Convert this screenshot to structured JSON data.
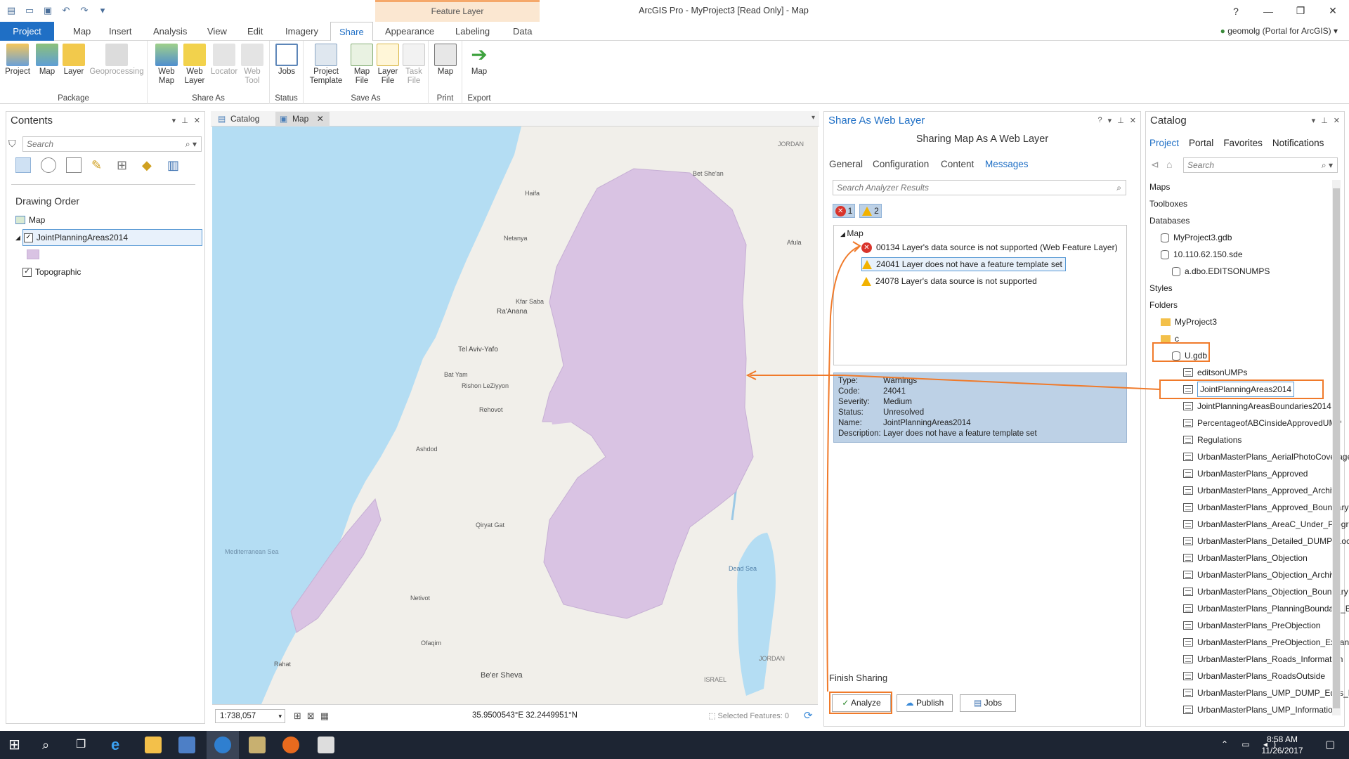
{
  "window": {
    "title": "ArcGIS Pro - MyProject3 [Read Only] - Map",
    "context_group": "Feature Layer",
    "help": "?",
    "portal_user": "geomolg (Portal for ArcGIS)"
  },
  "ribbon_tabs": [
    "Project",
    "Map",
    "Insert",
    "Analysis",
    "View",
    "Edit",
    "Imagery",
    "Share",
    "Appearance",
    "Labeling",
    "Data"
  ],
  "ribbon": {
    "package": {
      "label": "Package",
      "buttons": [
        "Project",
        "Map",
        "Layer",
        "Geoprocessing"
      ]
    },
    "share_as": {
      "label": "Share As",
      "buttons": [
        "Web Map",
        "Web Layer",
        "Locator",
        "Web Tool"
      ]
    },
    "status": {
      "label": "Status",
      "buttons": [
        "Jobs"
      ]
    },
    "save_as": {
      "label": "Save As",
      "buttons": [
        "Project Template",
        "Map File",
        "Layer File",
        "Task File"
      ]
    },
    "print": {
      "label": "Print",
      "buttons": [
        "Map"
      ]
    },
    "export": {
      "label": "Export",
      "buttons": [
        "Map"
      ]
    }
  },
  "contents": {
    "title": "Contents",
    "search_placeholder": "Search",
    "section": "Drawing Order",
    "map_item": "Map",
    "layer": "JointPlanningAreas2014",
    "basemap": "Topographic"
  },
  "map": {
    "tabs": [
      "Catalog",
      "Map"
    ],
    "scale": "1:738,057",
    "coords": "35.9500543°E 32.2449951°N",
    "selected": "Selected Features: 0",
    "labels": [
      "Haifa",
      "Netanya",
      "Ra'Anana",
      "Tel Aviv-Yafo",
      "Bat Yam",
      "Rishon LeZiyyon",
      "Rehovot",
      "Ashdod",
      "Qiryat Gat",
      "Netivot",
      "Rahat",
      "Ofaqim",
      "Be'er Sheva",
      "Dead Sea",
      "Mediterranean Sea",
      "JORDAN",
      "ISRAEL",
      "Afula",
      "Kfar Saba",
      "Bet She'an"
    ]
  },
  "share": {
    "title": "Share As Web Layer",
    "subtitle": "Sharing Map As A Web Layer",
    "subtabs": [
      "General",
      "Configuration",
      "Content",
      "Messages"
    ],
    "search_placeholder": "Search Analyzer Results",
    "error_count": "1",
    "warning_count": "2",
    "group": "Map",
    "messages": [
      {
        "type": "error",
        "text": "00134 Layer's data source is not supported (Web Feature Layer)"
      },
      {
        "type": "warning",
        "text": "24041 Layer does not have a feature template set"
      },
      {
        "type": "warning",
        "text": "24078 Layer's data source is not supported"
      }
    ],
    "details": [
      {
        "label": "Type:",
        "value": "Warnings"
      },
      {
        "label": "Code:",
        "value": "24041"
      },
      {
        "label": "Severity:",
        "value": "Medium"
      },
      {
        "label": "Status:",
        "value": "Unresolved"
      },
      {
        "label": "Name:",
        "value": "JointPlanningAreas2014"
      },
      {
        "label": "Description:",
        "value": "Layer does not have a feature template set"
      }
    ],
    "finish_label": "Finish Sharing",
    "buttons": [
      "Analyze",
      "Publish",
      "Jobs"
    ]
  },
  "catalog": {
    "title": "Catalog",
    "tabs": [
      "Project",
      "Portal",
      "Favorites",
      "Notifications"
    ],
    "search_placeholder": "Search",
    "items": [
      {
        "label": "Maps",
        "indent": 0,
        "icon": "none"
      },
      {
        "label": "Toolboxes",
        "indent": 0,
        "icon": "none"
      },
      {
        "label": "Databases",
        "indent": 0,
        "icon": "none"
      },
      {
        "label": "MyProject3.gdb",
        "indent": 1,
        "icon": "db"
      },
      {
        "label": "10.110.62.150.sde",
        "indent": 1,
        "icon": "db"
      },
      {
        "label": "a.dbo.EDITSONUMPS",
        "indent": 2,
        "icon": "db"
      },
      {
        "label": "Styles",
        "indent": 0,
        "icon": "none"
      },
      {
        "label": "Folders",
        "indent": 0,
        "icon": "none"
      },
      {
        "label": "MyProject3",
        "indent": 1,
        "icon": "folder"
      },
      {
        "label": "c",
        "indent": 1,
        "icon": "folder"
      },
      {
        "label": "U.gdb",
        "indent": 2,
        "icon": "db"
      },
      {
        "label": "editsonUMPs",
        "indent": 3,
        "icon": "table"
      },
      {
        "label": "JointPlanningAreas2014",
        "indent": 3,
        "icon": "table"
      },
      {
        "label": "JointPlanningAreasBoundaries2014",
        "indent": 3,
        "icon": "table"
      },
      {
        "label": "PercentageofABCinsideApprovedUMP",
        "indent": 3,
        "icon": "table"
      },
      {
        "label": "Regulations",
        "indent": 3,
        "icon": "table"
      },
      {
        "label": "UrbanMasterPlans_AerialPhotoCoverage",
        "indent": 3,
        "icon": "table"
      },
      {
        "label": "UrbanMasterPlans_Approved",
        "indent": 3,
        "icon": "table"
      },
      {
        "label": "UrbanMasterPlans_Approved_Archive",
        "indent": 3,
        "icon": "table"
      },
      {
        "label": "UrbanMasterPlans_Approved_Boundary",
        "indent": 3,
        "icon": "table"
      },
      {
        "label": "UrbanMasterPlans_AreaC_Under_Progress",
        "indent": 3,
        "icon": "table"
      },
      {
        "label": "UrbanMasterPlans_Detailed_DUMP_Locations",
        "indent": 3,
        "icon": "point"
      },
      {
        "label": "UrbanMasterPlans_Objection",
        "indent": 3,
        "icon": "table"
      },
      {
        "label": "UrbanMasterPlans_Objection_Archive",
        "indent": 3,
        "icon": "table"
      },
      {
        "label": "UrbanMasterPlans_Objection_Boundary",
        "indent": 3,
        "icon": "table"
      },
      {
        "label": "UrbanMasterPlans_PlanningBoundary_E",
        "indent": 3,
        "icon": "table"
      },
      {
        "label": "UrbanMasterPlans_PreObjection",
        "indent": 3,
        "icon": "table"
      },
      {
        "label": "UrbanMasterPlans_PreObjection_Expansion",
        "indent": 3,
        "icon": "table"
      },
      {
        "label": "UrbanMasterPlans_Roads_Information",
        "indent": 3,
        "icon": "point"
      },
      {
        "label": "UrbanMasterPlans_RoadsOutside",
        "indent": 3,
        "icon": "point"
      },
      {
        "label": "UrbanMasterPlans_UMP_DUMP_Edits_Locations",
        "indent": 3,
        "icon": "point"
      },
      {
        "label": "UrbanMasterPlans_UMP_Information",
        "indent": 3,
        "icon": "table"
      }
    ]
  },
  "taskbar": {
    "time": "8:58 AM",
    "date": "11/26/2017"
  }
}
